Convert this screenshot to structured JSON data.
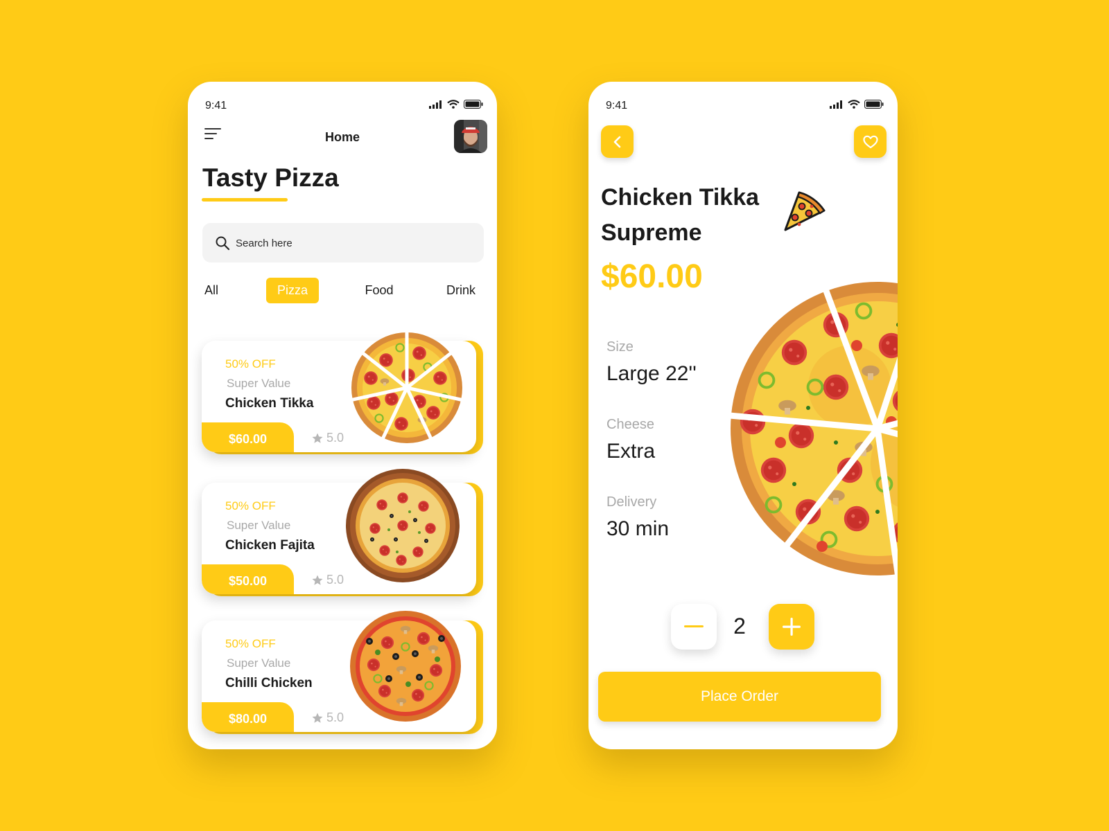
{
  "colors": {
    "accent": "#FFCB16",
    "background": "#FFCB16",
    "text": "#1a1a1a",
    "muted": "#a8a8a8"
  },
  "home": {
    "status_time": "9:41",
    "header_title": "Home",
    "page_title": "Tasty Pizza",
    "search": {
      "placeholder": "Search here"
    },
    "tabs": [
      {
        "label": "All",
        "active": false
      },
      {
        "label": "Pizza",
        "active": true
      },
      {
        "label": "Food",
        "active": false
      },
      {
        "label": "Drink",
        "active": false
      }
    ],
    "items": [
      {
        "discount": "50% OFF",
        "tagline": "Super Value",
        "name": "Chicken Tikka",
        "price": "$60.00",
        "rating": "5.0"
      },
      {
        "discount": "50% OFF",
        "tagline": "Super Value",
        "name": "Chicken Fajita",
        "price": "$50.00",
        "rating": "5.0"
      },
      {
        "discount": "50% OFF",
        "tagline": "Super Value",
        "name": "Chilli Chicken",
        "price": "$80.00",
        "rating": "5.0"
      }
    ]
  },
  "detail": {
    "status_time": "9:41",
    "name_line1": "Chicken Tikka",
    "name_line2": "Supreme",
    "price": "$60.00",
    "specs": [
      {
        "label": "Size",
        "value": "Large 22''"
      },
      {
        "label": "Cheese",
        "value": "Extra"
      },
      {
        "label": "Delivery",
        "value": "30 min"
      }
    ],
    "quantity": "2",
    "order_label": "Place Order"
  }
}
